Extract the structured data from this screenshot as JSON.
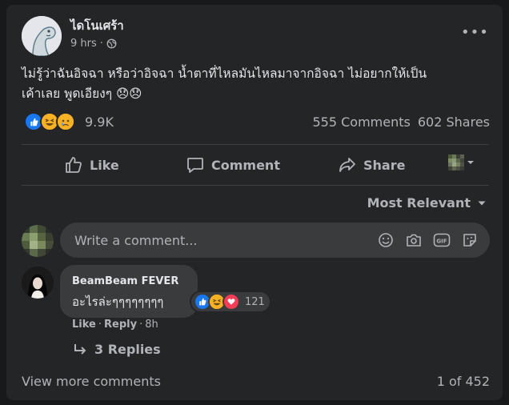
{
  "post": {
    "page_name": "ไดโนเศร้า",
    "time": "9 hrs",
    "audience_icon": "globe-icon",
    "text_line1": "ไม่รู้ว่าฉันอิจฉา หรือว่าอิจฉา น้ำตาที่ไหลมันไหลมาจากอิจฉา ไม่อยากให้เป็น",
    "text_line2": "เค้าเลย พูดเอียงๆ 😞😞"
  },
  "engagement": {
    "reaction_count": "9.9K",
    "comments": "555 Comments",
    "shares": "602 Shares",
    "reactions": [
      "like",
      "haha",
      "sad"
    ]
  },
  "actions": {
    "like": "Like",
    "comment": "Comment",
    "share": "Share"
  },
  "sort": {
    "label": "Most Relevant"
  },
  "comment_input": {
    "placeholder": "Write a comment..."
  },
  "comment": {
    "author": "BeamBeam FEVER",
    "text": "อะไรล่ะๆๆๆๆๆๆๆๆ",
    "reaction_count": "121",
    "reactions": [
      "like",
      "haha",
      "love"
    ],
    "like_label": "Like",
    "reply_label": "Reply",
    "time": "8h",
    "replies": "3 Replies"
  },
  "footer": {
    "view_more": "View more comments",
    "pager": "1 of 452"
  },
  "colors": {
    "background": "#18191a",
    "card": "#242526",
    "input": "#3a3b3c",
    "primary_text": "#e4e6eb",
    "secondary_text": "#b0b3b8",
    "like_blue": "#1877f2",
    "haha_yellow": "#f7b125",
    "love_red": "#f33e58"
  }
}
